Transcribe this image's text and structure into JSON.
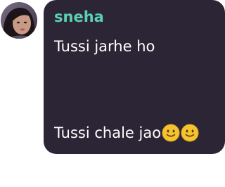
{
  "message": {
    "sender_name": "sneha",
    "text_line_1": "Tussi jarhe ho",
    "text_line_2": "Tussi chale jao",
    "emojis": [
      "slightly-smiling-face",
      "slightly-smiling-face"
    ]
  },
  "colors": {
    "bubble_background": "#2b2535",
    "sender_name": "#5bd1b3",
    "message_text": "#ffffff",
    "emoji_face": "#f5c330"
  }
}
